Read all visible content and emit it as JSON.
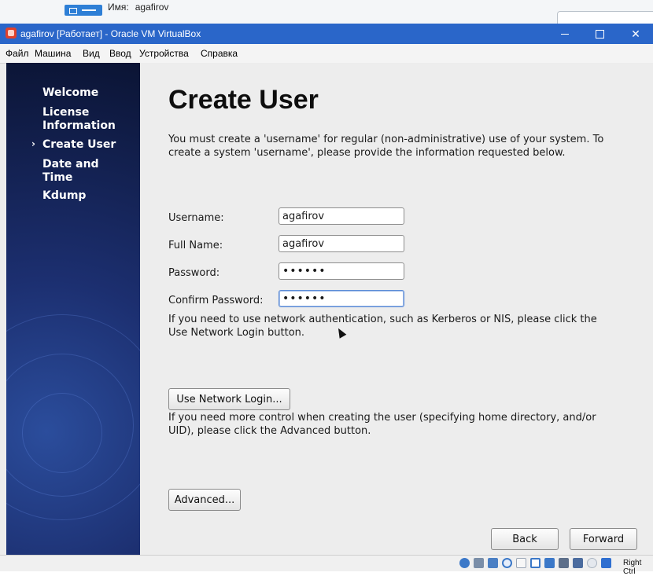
{
  "behind_window": {
    "name_label": "Имя:",
    "name_value": "agafirov"
  },
  "window": {
    "title": "agafirov [Работает] - Oracle VM VirtualBox",
    "close_glyph": "✕"
  },
  "menubar": {
    "items": [
      "Файл",
      "Машина",
      "Вид",
      "Ввод",
      "Устройства",
      "Справка"
    ]
  },
  "sidebar": {
    "items": [
      {
        "label": "Welcome"
      },
      {
        "label": "License\nInformation"
      },
      {
        "label": "Create User",
        "current": true
      },
      {
        "label": "Date and\nTime"
      },
      {
        "label": "Kdump"
      }
    ],
    "current_marker": "›"
  },
  "page": {
    "title": "Create User",
    "intro": "You must create a 'username' for regular (non-administrative) use of your system.  To create a system 'username', please provide the information requested below.",
    "fields": {
      "username": {
        "label": "Username:",
        "value": "agafirov"
      },
      "fullname": {
        "label": "Full Name:",
        "value": "agafirov"
      },
      "password": {
        "label": "Password:",
        "value": "••••••"
      },
      "confirm": {
        "label": "Confirm Password:",
        "value": "••••••"
      }
    },
    "network_text": "If you need to use network authentication, such as Kerberos or NIS, please click the Use Network Login button.",
    "network_button": "Use Network Login...",
    "advanced_text": "If you need more control when creating the user (specifying home directory, and/or UID), please click the Advanced button.",
    "advanced_button": "Advanced...",
    "back_button": "Back",
    "forward_button": "Forward"
  },
  "statusbar": {
    "host_key": "Right Ctrl",
    "icons": [
      "hard-disk-icon",
      "optical-drive-icon",
      "audio-icon",
      "network-icon",
      "usb-icon",
      "shared-folders-icon",
      "display-icon",
      "video-capture-icon",
      "cpu-icon",
      "mouse-integration-icon",
      "keyboard-icon"
    ]
  }
}
